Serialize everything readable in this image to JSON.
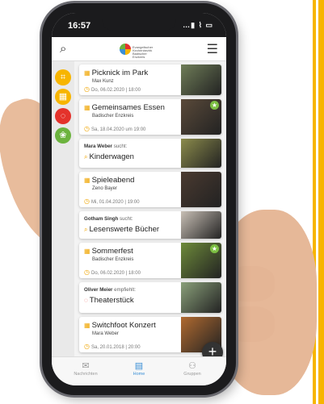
{
  "status_bar": {
    "time": "16:57",
    "signal": "…▮ ⌇ ▭"
  },
  "topbar": {
    "search_icon": "⌕",
    "menu_icon": "☰",
    "logo_text": "Evangelischer Kirchenbezirk Badischer Enzkreis"
  },
  "sidebar": {
    "categories": [
      {
        "name": "events",
        "color": "#f7b500",
        "glyph": "⌗"
      },
      {
        "name": "calendar",
        "color": "#f7b500",
        "glyph": "▦"
      },
      {
        "name": "recommendations",
        "color": "#e4322b",
        "glyph": "◌"
      },
      {
        "name": "search",
        "color": "#6cb33e",
        "glyph": "❀"
      }
    ]
  },
  "cards": [
    {
      "title": "Picknick im Park",
      "subtitle": "Max Kunz",
      "meta": "Do, 06.02.2020 | 18:00",
      "icon": "▦",
      "meta_icon": "◷",
      "image_color": "#6f7d58",
      "starred": false
    },
    {
      "title": "Gemeinsames Essen",
      "subtitle": "Badischer Enzkreis",
      "meta": "Sa, 18.04.2020 um 19:00",
      "icon": "▦",
      "meta_icon": "◷",
      "image_color": "#5a4a3a",
      "starred": true
    },
    {
      "who_name": "Mara Weber",
      "who_action": "sucht:",
      "title": "Kinderwagen",
      "icon": "⌕",
      "image_color": "#8b8b4b"
    },
    {
      "title": "Spieleabend",
      "subtitle": "Zeno Bayer",
      "meta": "Mi, 01.04.2020 | 19:00",
      "icon": "▦",
      "meta_icon": "◷",
      "image_color": "#4a3a30",
      "starred": false
    },
    {
      "who_name": "Gotham Singh",
      "who_action": "sucht:",
      "title": "Lesenswerte Bücher",
      "icon": "⌕",
      "image_color": "#c8bfb5"
    },
    {
      "title": "Sommerfest",
      "subtitle": "Badischer Enzkreis",
      "meta": "Do, 06.02.2020 | 18:00",
      "icon": "▦",
      "meta_icon": "◷",
      "image_color": "#6d8a3a",
      "starred": true
    },
    {
      "who_name": "Oliver Meier",
      "who_action": "empfiehlt:",
      "title": "Theaterstück",
      "icon": "◌",
      "image_color": "#8aa07a"
    },
    {
      "title": "Switchfoot Konzert",
      "subtitle": "Mara Weber",
      "meta": "Sa, 20.01.2018 | 20:00",
      "icon": "▦",
      "meta_icon": "◷",
      "image_color": "#b06a30",
      "starred": false
    }
  ],
  "fab": {
    "label": "+"
  },
  "bottom_nav": [
    {
      "label": "Nachrichten",
      "icon": "✉",
      "active": false
    },
    {
      "label": "Home",
      "icon": "▤",
      "active": true
    },
    {
      "label": "Gruppen",
      "icon": "⚇",
      "active": false
    }
  ],
  "colors": {
    "accent": "#f7b500",
    "brand_red": "#e4322b",
    "brand_green": "#6cb33e",
    "brand_blue": "#3a8fd6"
  }
}
